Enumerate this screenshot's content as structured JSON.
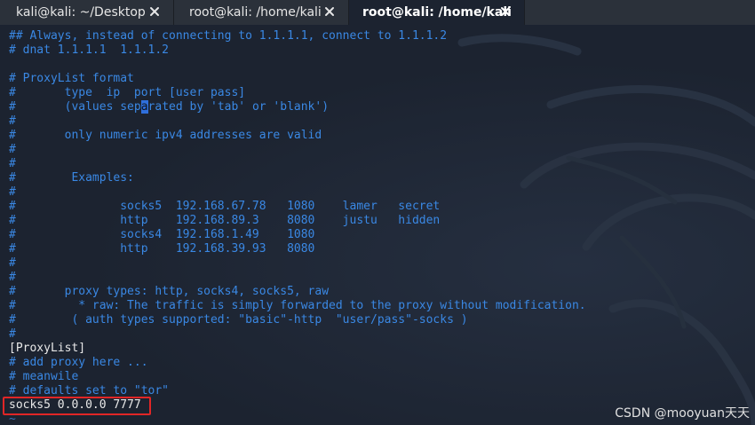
{
  "tabs": [
    {
      "label": "kali@kali: ~/Desktop",
      "active": false
    },
    {
      "label": "root@kali: /home/kali",
      "active": false
    },
    {
      "label": "root@kali: /home/kali",
      "active": true
    }
  ],
  "terminal": {
    "lines": [
      "## Always, instead of connecting to 1.1.1.1, connect to 1.1.1.2",
      "# dnat 1.1.1.1  1.1.1.2",
      "",
      "# ProxyList format",
      "#       type  ip  port [user pass]",
      "#       (values separated by 'tab' or 'blank')",
      "#",
      "#       only numeric ipv4 addresses are valid",
      "#",
      "#",
      "#        Examples:",
      "#",
      "#               socks5  192.168.67.78   1080    lamer   secret",
      "#               http    192.168.89.3    8080    justu   hidden",
      "#               socks4  192.168.1.49    1080",
      "#               http    192.168.39.93   8080",
      "#",
      "#",
      "#       proxy types: http, socks4, socks5, raw",
      "#         * raw: The traffic is simply forwarded to the proxy without modification.",
      "#        ( auth types supported: \"basic\"-http  \"user/pass\"-socks )",
      "#",
      "[ProxyList]",
      "# add proxy here ...",
      "# meanwile",
      "# defaults set to \"tor\"",
      "socks5 0.0.0.0 7777",
      "~"
    ],
    "cursor": {
      "line": 5,
      "column": 19
    },
    "plain_lines": [
      22,
      26
    ],
    "tilde_lines": [
      27
    ],
    "highlighted_line": "socks5 0.0.0.0 7777"
  },
  "watermark": "CSDN @mooyuan天天",
  "colors": {
    "comment": "#3a88e4",
    "text": "#e8e8e8",
    "background": "#1c2330",
    "highlight_box": "#e12626",
    "cursor": "#2f6fdc"
  },
  "icons": {
    "tab_close": "close-icon",
    "background_logo": "kali-dragon-logo"
  }
}
